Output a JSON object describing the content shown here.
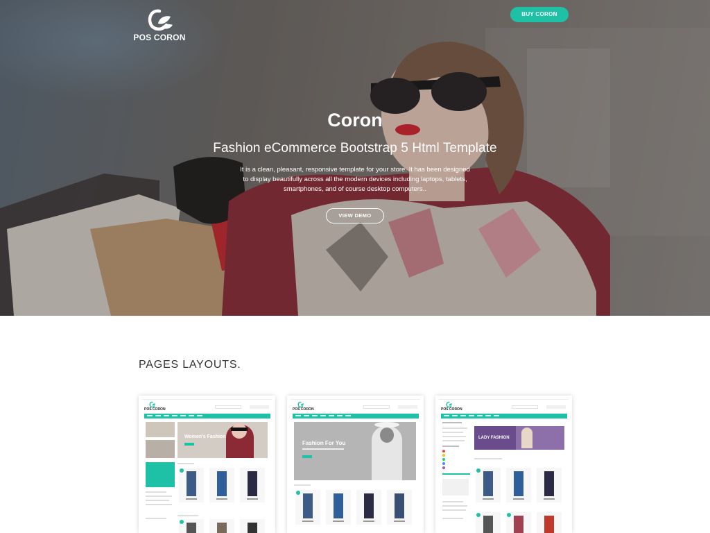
{
  "header": {
    "logo_text": "POS CORON",
    "buy_button": "BUY CORON"
  },
  "hero": {
    "title": "Coron",
    "subtitle": "Fashion eCommerce Bootstrap 5 Html Template",
    "description": "It is a clean, pleasant, responsive template for your store. It has been designed to display beautifully across all the modern devices including laptops, tablets, smartphones, and of course desktop computers..",
    "demo_button": "VIEW DEMO"
  },
  "layouts": {
    "title": "PAGES LAYOUTS.",
    "cards": [
      {
        "logo": "POS CORON",
        "banner_text": "Women's Fashion"
      },
      {
        "logo": "POS CORON",
        "banner_text": "Fashion For You"
      },
      {
        "logo": "POS CORON",
        "banner_text": "LADY FASHION"
      }
    ]
  },
  "colors": {
    "accent": "#1ec1a6",
    "text_dark": "#333333"
  },
  "icons": {
    "logo_mark": "leaf-c-logo-icon"
  }
}
